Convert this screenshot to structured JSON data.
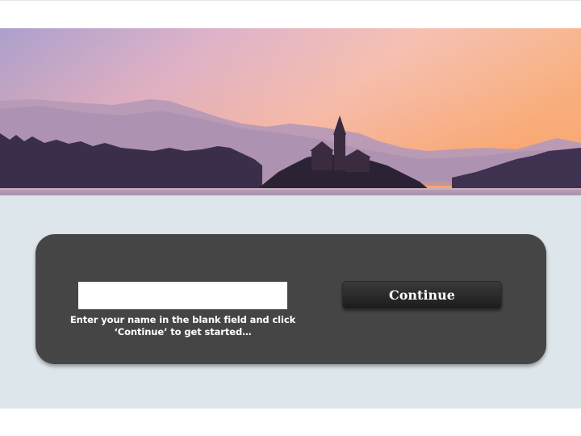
{
  "banner": {
    "image": "sunset-lake-church-landscape"
  },
  "form": {
    "name_value": "",
    "name_placeholder": "",
    "instructions_line1": "Enter your name in the blank field and click",
    "instructions_line2": "‘Continue’ to get started…",
    "continue_label": "Continue"
  },
  "colors": {
    "panel": "#454545",
    "stage_background": "#dde6eb",
    "button": "#262626",
    "text": "#ffffff"
  }
}
